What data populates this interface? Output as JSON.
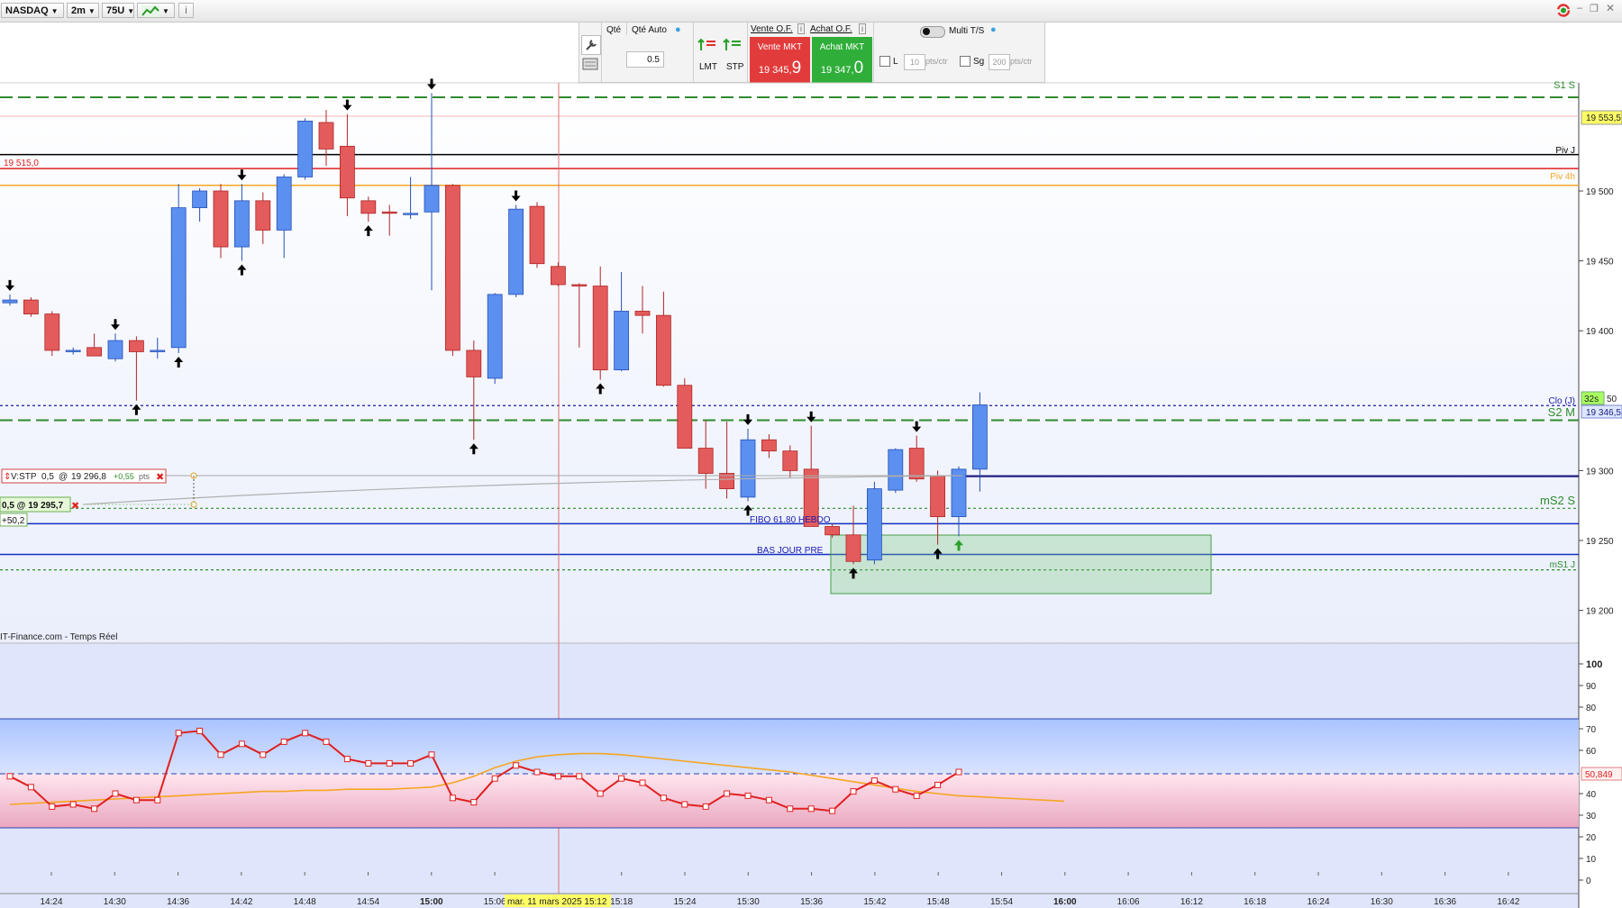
{
  "toolbar": {
    "symbol": "NASDAQ",
    "timeframe": "2m",
    "units": "75U",
    "chart_type_icon": "chart-type-icon",
    "info_icon": "info-icon",
    "right_icons": [
      "refresh-icon",
      "minimize-icon",
      "restore-icon",
      "close-icon"
    ]
  },
  "order_panel": {
    "qty_label": "Qté",
    "qty_auto_label": "Qté Auto",
    "qty_value": "0.5",
    "lmt_label": "LMT",
    "stp_label": "STP",
    "sell_of_label": "Vente O.F.",
    "buy_of_label": "Achat O.F.",
    "sell_mkt_label": "Vente MKT",
    "sell_price_main": "19 345,",
    "sell_price_big": "9",
    "buy_mkt_label": "Achat MKT",
    "buy_price_main": "19 347,",
    "buy_price_big": "0",
    "multi_ts_label": "Multi T/S",
    "l_label": "L",
    "l_value": "10",
    "l_unit": "pts/ctr",
    "sg_label": "Sg",
    "sg_value": "200",
    "sg_unit": "pts/ctr",
    "colors": {
      "sell": "#e23b3b",
      "buy": "#2fae3a"
    }
  },
  "price_axis": {
    "ticks": [
      "19 500",
      "19 450",
      "19 400",
      "19 300",
      "19 250",
      "19 200"
    ],
    "tick_values": [
      19500,
      19450,
      19400,
      19300,
      19250,
      19200
    ],
    "tag_top": "19 553,5",
    "tag_countdown": "32s",
    "tag_last": "19 346,5",
    "tag_fragment": "50"
  },
  "levels": [
    {
      "label": "S1 S",
      "price": 19567,
      "color": "#2e8b2e",
      "style": "dash-thick"
    },
    {
      "label": "",
      "price": 19553.5,
      "color": "#f0a0a0",
      "style": "solid-thin"
    },
    {
      "label": "Piv J",
      "price": 19526,
      "color": "#000000",
      "style": "solid"
    },
    {
      "label": "19 515,0",
      "price": 19516,
      "color": "#e02020",
      "style": "solid",
      "side": "left"
    },
    {
      "label": "Piv 4h",
      "price": 19504,
      "color": "#f5a623",
      "style": "solid"
    },
    {
      "label": "Clo (J)",
      "price": 19346.5,
      "color": "#1a1aa0",
      "style": "dotted"
    },
    {
      "label": "S2 M",
      "price": 19336,
      "color": "#2e8b2e",
      "style": "dash-thick"
    },
    {
      "label": "",
      "price": 19296,
      "color": "#202080",
      "style": "solid-thick"
    },
    {
      "label": "mS2 S",
      "price": 19273,
      "color": "#2e8b2e",
      "style": "dotted"
    },
    {
      "label": "",
      "price": 19262,
      "color": "#1030c0",
      "style": "solid"
    },
    {
      "label": "mS1 J",
      "price": 19229,
      "color": "#2e8b2e",
      "style": "dotted"
    },
    {
      "label": "",
      "price": 19240,
      "color": "#1030c0",
      "style": "solid"
    }
  ],
  "annotations": {
    "fibo_label": "FIBO 61.80 HEBDO",
    "bas_jour_label": "BAS JOUR PRE",
    "order_line_label": "V:STP",
    "order_qty": "0,5",
    "order_at": "@",
    "order_price": "19 296,8",
    "order_pts": "+0,55",
    "order_pts_unit": "pts",
    "position_label": "0,5 @ 19 295,7",
    "position_pnl": "+50,2",
    "source_label": "IT-Finance.com - Temps Réel"
  },
  "time_axis": {
    "labels": [
      "14:24",
      "14:30",
      "14:36",
      "14:42",
      "14:48",
      "14:54",
      "15:00",
      "15:06",
      "15:18",
      "15:24",
      "15:30",
      "15:36",
      "15:42",
      "15:48",
      "15:54",
      "16:00",
      "16:06",
      "16:12",
      "16:18",
      "16:24",
      "16:30",
      "16:36",
      "16:42"
    ],
    "crosshair_label": "mar. 11 mars 2025 15:12"
  },
  "oscillator": {
    "ticks": [
      "100",
      "90",
      "80",
      "70",
      "60",
      "40",
      "30",
      "20",
      "10",
      "0"
    ],
    "current_value": "50,849",
    "main_values": [
      48,
      43,
      34,
      35,
      33,
      40,
      37,
      37,
      68,
      69,
      58,
      63,
      58,
      64,
      68,
      64,
      56,
      54,
      54,
      54,
      58,
      38,
      36,
      47,
      53,
      50,
      48,
      48,
      40,
      47,
      45,
      38,
      35,
      34,
      40,
      39,
      37,
      33,
      33,
      32,
      41,
      46,
      42,
      39,
      44,
      50
    ],
    "signal_values": [
      35,
      35.5,
      36,
      36.5,
      37,
      37.5,
      38,
      38.5,
      39,
      39.5,
      40,
      40.5,
      41,
      41,
      41.5,
      41.5,
      42,
      42,
      42,
      42.5,
      43,
      45,
      48,
      52,
      55,
      57,
      58,
      58.5,
      58.5,
      58,
      57,
      56,
      55,
      54,
      53,
      52,
      51,
      50,
      48.5,
      47,
      45.5,
      44,
      42.5,
      41,
      40,
      39,
      38.5,
      38,
      37.5,
      37,
      36.5
    ],
    "bands": {
      "upper": 75,
      "mid": 50,
      "lower": 25
    }
  },
  "chart_data": {
    "type": "candlestick",
    "symbol": "NASDAQ",
    "timeframe": "2m",
    "candles": [
      {
        "o": 19420,
        "h": 19426,
        "l": 19418,
        "c": 19422
      },
      {
        "o": 19422,
        "h": 19424,
        "l": 19410,
        "c": 19412
      },
      {
        "o": 19412,
        "h": 19414,
        "l": 19382,
        "c": 19386
      },
      {
        "o": 19385,
        "h": 19388,
        "l": 19383,
        "c": 19386
      },
      {
        "o": 19388,
        "h": 19398,
        "l": 19383,
        "c": 19382
      },
      {
        "o": 19380,
        "h": 19398,
        "l": 19378,
        "c": 19393
      },
      {
        "o": 19393,
        "h": 19396,
        "l": 19350,
        "c": 19385
      },
      {
        "o": 19385,
        "h": 19395,
        "l": 19380,
        "c": 19386
      },
      {
        "o": 19388,
        "h": 19505,
        "l": 19384,
        "c": 19488
      },
      {
        "o": 19488,
        "h": 19502,
        "l": 19478,
        "c": 19500
      },
      {
        "o": 19500,
        "h": 19505,
        "l": 19452,
        "c": 19460
      },
      {
        "o": 19460,
        "h": 19505,
        "l": 19450,
        "c": 19493
      },
      {
        "o": 19493,
        "h": 19499,
        "l": 19462,
        "c": 19472
      },
      {
        "o": 19472,
        "h": 19512,
        "l": 19452,
        "c": 19510
      },
      {
        "o": 19510,
        "h": 19552,
        "l": 19508,
        "c": 19550
      },
      {
        "o": 19549,
        "h": 19558,
        "l": 19518,
        "c": 19530
      },
      {
        "o": 19532,
        "h": 19555,
        "l": 19482,
        "c": 19495
      },
      {
        "o": 19493,
        "h": 19496,
        "l": 19478,
        "c": 19484
      },
      {
        "o": 19485,
        "h": 19490,
        "l": 19468,
        "c": 19484
      },
      {
        "o": 19484,
        "h": 19510,
        "l": 19480,
        "c": 19484
      },
      {
        "o": 19485,
        "h": 19570,
        "l": 19429,
        "c": 19504
      },
      {
        "o": 19504,
        "h": 19505,
        "l": 19382,
        "c": 19386
      },
      {
        "o": 19386,
        "h": 19393,
        "l": 19322,
        "c": 19367
      },
      {
        "o": 19366,
        "h": 19427,
        "l": 19362,
        "c": 19426
      },
      {
        "o": 19426,
        "h": 19490,
        "l": 19424,
        "c": 19487
      },
      {
        "o": 19489,
        "h": 19492,
        "l": 19445,
        "c": 19448
      },
      {
        "o": 19446,
        "h": 19449,
        "l": 19432,
        "c": 19433
      },
      {
        "o": 19433,
        "h": 19434,
        "l": 19388,
        "c": 19432
      },
      {
        "o": 19432,
        "h": 19446,
        "l": 19365,
        "c": 19372
      },
      {
        "o": 19372,
        "h": 19442,
        "l": 19371,
        "c": 19414
      },
      {
        "o": 19414,
        "h": 19432,
        "l": 19398,
        "c": 19411
      },
      {
        "o": 19411,
        "h": 19428,
        "l": 19360,
        "c": 19361
      },
      {
        "o": 19361,
        "h": 19366,
        "l": 19316,
        "c": 19316
      },
      {
        "o": 19316,
        "h": 19336,
        "l": 19287,
        "c": 19298
      },
      {
        "o": 19298,
        "h": 19335,
        "l": 19280,
        "c": 19287
      },
      {
        "o": 19281,
        "h": 19330,
        "l": 19278,
        "c": 19322
      },
      {
        "o": 19322,
        "h": 19326,
        "l": 19309,
        "c": 19314
      },
      {
        "o": 19314,
        "h": 19318,
        "l": 19295,
        "c": 19300
      },
      {
        "o": 19301,
        "h": 19332,
        "l": 19262,
        "c": 19260
      },
      {
        "o": 19260,
        "h": 19262,
        "l": 19252,
        "c": 19254
      },
      {
        "o": 19254,
        "h": 19275,
        "l": 19233,
        "c": 19235
      },
      {
        "o": 19236,
        "h": 19292,
        "l": 19233,
        "c": 19287
      },
      {
        "o": 19286,
        "h": 19316,
        "l": 19284,
        "c": 19315
      },
      {
        "o": 19316,
        "h": 19325,
        "l": 19292,
        "c": 19294
      },
      {
        "o": 19296,
        "h": 19300,
        "l": 19247,
        "c": 19267
      },
      {
        "o": 19267,
        "h": 19303,
        "l": 19253,
        "c": 19301
      },
      {
        "o": 19301,
        "h": 19356,
        "l": 19285,
        "c": 19347
      }
    ]
  }
}
